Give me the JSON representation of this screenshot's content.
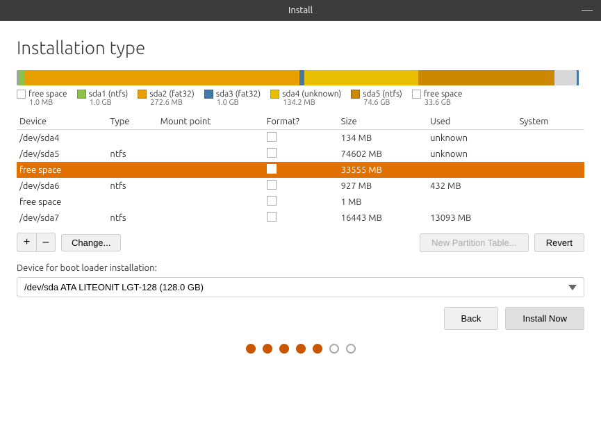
{
  "titlebar": {
    "title": "Install",
    "minimize": "—"
  },
  "page": {
    "title": "Installation type"
  },
  "disk_bar": {
    "segments": [
      {
        "color": "#5f9ea0",
        "width": 0.5,
        "label": ""
      },
      {
        "color": "#e8a000",
        "width": 6.5,
        "label": ""
      },
      {
        "color": "#e8a000",
        "width": 49,
        "label": ""
      },
      {
        "color": "#4477aa",
        "width": 6.5,
        "label": ""
      },
      {
        "color": "#e8a000",
        "width": 22,
        "label": ""
      },
      {
        "color": "#dd8800",
        "width": 11,
        "label": ""
      },
      {
        "color": "#d0d0d0",
        "width": 4.5,
        "label": ""
      }
    ]
  },
  "legend": [
    {
      "color": "",
      "border": "#aaa",
      "label": "free space",
      "size": "1.0 MB",
      "outline": true
    },
    {
      "color": "#8bc34a",
      "label": "sda1 (ntfs)",
      "size": "1.0 GB"
    },
    {
      "color": "#e8a000",
      "label": "sda2 (fat32)",
      "size": "272.6 MB"
    },
    {
      "color": "#4477aa",
      "label": "sda3 (fat32)",
      "size": "1.0 GB"
    },
    {
      "color": "#e8a000",
      "label": "sda4 (unknown)",
      "size": "134.2 MB"
    },
    {
      "color": "#dd8800",
      "label": "sda5 (ntfs)",
      "size": "74.6 GB"
    },
    {
      "color": "",
      "border": "#aaa",
      "label": "free space",
      "size": "33.6 GB",
      "outline": true
    },
    {
      "color": "#4477aa",
      "label": "",
      "size": ""
    }
  ],
  "table": {
    "headers": [
      "Device",
      "Type",
      "Mount point",
      "Format?",
      "Size",
      "Used",
      "System"
    ],
    "rows": [
      {
        "device": "/dev/sda4",
        "type": "",
        "mount": "",
        "format": false,
        "size": "134 MB",
        "used": "unknown",
        "system": "",
        "selected": false
      },
      {
        "device": "/dev/sda5",
        "type": "ntfs",
        "mount": "",
        "format": false,
        "size": "74602 MB",
        "used": "unknown",
        "system": "",
        "selected": false
      },
      {
        "device": "free space",
        "type": "",
        "mount": "",
        "format": false,
        "size": "33555 MB",
        "used": "",
        "system": "",
        "selected": true
      },
      {
        "device": "/dev/sda6",
        "type": "ntfs",
        "mount": "",
        "format": false,
        "size": "927 MB",
        "used": "432 MB",
        "system": "",
        "selected": false
      },
      {
        "device": "free space",
        "type": "",
        "mount": "",
        "format": false,
        "size": "1 MB",
        "used": "",
        "system": "",
        "selected": false
      },
      {
        "device": "/dev/sda7",
        "type": "ntfs",
        "mount": "",
        "format": false,
        "size": "16443 MB",
        "used": "13093 MB",
        "system": "",
        "selected": false
      }
    ]
  },
  "actions": {
    "add": "+",
    "remove": "–",
    "change": "Change...",
    "new_partition_table": "New Partition Table...",
    "revert": "Revert"
  },
  "bootloader": {
    "label": "Device for boot loader installation:",
    "value": "/dev/sda   ATA LITEONIT LGT-128 (128.0 GB)"
  },
  "nav": {
    "back": "Back",
    "install_now": "Install Now"
  },
  "dots": {
    "filled": 5,
    "empty": 2
  }
}
